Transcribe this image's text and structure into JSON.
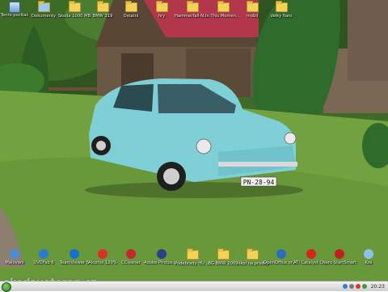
{
  "desktop": {
    "top_icons": [
      {
        "label": "Tento počítač",
        "icon": "computer-icon"
      },
      {
        "label": "Dokumenty",
        "icon": "documents-folder-icon"
      },
      {
        "label": "Škoda 1000 MB",
        "icon": "folder-icon"
      },
      {
        "label": "BMW 319",
        "icon": "folder-icon"
      },
      {
        "label": "Ostatní",
        "icon": "folder-icon"
      },
      {
        "label": "hry",
        "icon": "folder-icon"
      },
      {
        "label": "Hammerfall-No Sacrifice,No...",
        "icon": "folder-icon"
      },
      {
        "label": "In This Moment - Call Me (M...",
        "icon": "folder-icon"
      },
      {
        "label": "mobil",
        "icon": "folder-icon"
      },
      {
        "label": "Velký fiaro",
        "icon": "folder-icon"
      }
    ],
    "bottom_icons": [
      {
        "label": "Malování",
        "icon": "paint-icon",
        "color": "#4a8fd6"
      },
      {
        "label": "DVDFab 6",
        "icon": "dvdfab-icon",
        "color": "#2a7ad0"
      },
      {
        "label": "TeamViewer 5",
        "icon": "teamviewer-icon",
        "color": "#1a6fc9"
      },
      {
        "label": "Alcohol 120%",
        "icon": "alcohol-icon",
        "color": "#d9312a"
      },
      {
        "label": "CCleaner",
        "icon": "ccleaner-icon",
        "color": "#c5282a"
      },
      {
        "label": "Adobe Photoshop ...",
        "icon": "photoshop-icon",
        "color": "#2d3f8a"
      },
      {
        "label": "Podebrady HU 2009",
        "icon": "folder-icon",
        "color": "#f3d25a"
      },
      {
        "label": "BG BMW 2009",
        "icon": "folder-icon",
        "color": "#f3d25a"
      },
      {
        "label": "nikol na prodej",
        "icon": "folder-icon",
        "color": "#f3d25a"
      },
      {
        "label": "OpenOffice.org 3.0",
        "icon": "openoffice-icon",
        "color": "#2b6fb6"
      },
      {
        "label": "ATI Catalyst Control Center",
        "icon": "ati-icon",
        "color": "#d2261f"
      },
      {
        "label": "Nero StartSmart",
        "icon": "nero-icon",
        "color": "#c21f1f"
      },
      {
        "label": "Koš",
        "icon": "recycle-bin-icon",
        "color": "#8ec1e8"
      }
    ]
  },
  "taskbar": {
    "clock": "20:23"
  },
  "watermark": "skodaveteran.cz",
  "colors": {
    "car_body": "#7fd0d6",
    "roof": "#a7384a",
    "grass": "#6f9e3c",
    "taskbar": "#dcdcdc"
  }
}
